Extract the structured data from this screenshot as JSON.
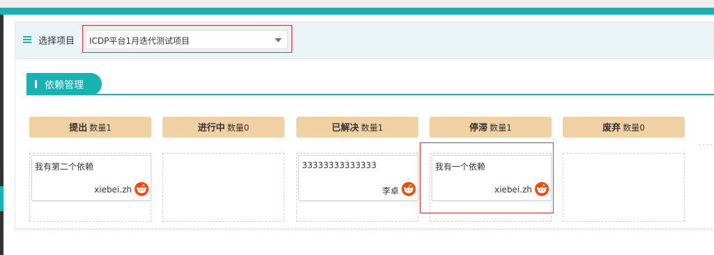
{
  "header": {
    "select_label": "选择项目",
    "project_value": "ICDP平台1月迭代测试项目"
  },
  "tab": {
    "title": "依赖管理"
  },
  "columns": [
    {
      "title": "提出",
      "count": "数量1",
      "cards": [
        {
          "text": "我有第二个依赖",
          "user": "xiebei.zh",
          "icon": "reddit-alien-icon"
        }
      ]
    },
    {
      "title": "进行中",
      "count": "数量0",
      "cards": []
    },
    {
      "title": "已解决",
      "count": "数量1",
      "cards": [
        {
          "text": "33333333333333",
          "user": "李卓",
          "icon": "reddit-alien-icon"
        }
      ]
    },
    {
      "title": "停滞",
      "count": "数量1",
      "cards": [
        {
          "text": "我有一个依赖",
          "user": "xiebei.zh",
          "icon": "reddit-alien-icon"
        }
      ]
    },
    {
      "title": "废弃",
      "count": "数量0",
      "cards": []
    }
  ],
  "colors": {
    "accent": "#16b3b3",
    "column_header": "#efd1a4",
    "highlight_border": "#d9342f",
    "avatar": "#ff4500"
  }
}
